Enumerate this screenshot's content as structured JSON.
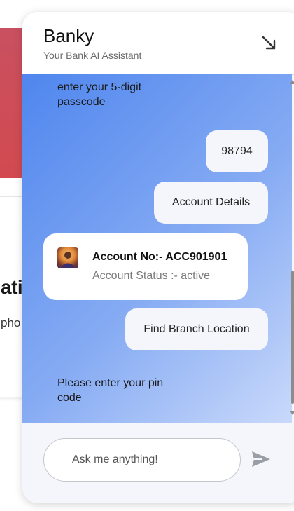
{
  "background": {
    "heading_fragment": "atio",
    "subtext_fragment": "pho"
  },
  "chat": {
    "title": "Banky",
    "subtitle": "Your Bank AI Assistant",
    "minimize_icon": "arrow-down-right-icon",
    "messages": {
      "bot_prompt_partial_line1": "enter your 5-digit",
      "bot_prompt_partial_line2": "passcode",
      "user_passcode": "98794",
      "user_account_details": "Account Details",
      "account_card": {
        "account_no": "Account No:- ACC901901",
        "account_status": "Account Status :- active"
      },
      "user_find_branch": "Find Branch Location",
      "bot_pin_prompt_line1": "Please enter your pin",
      "bot_pin_prompt_line2": "code"
    },
    "input": {
      "placeholder": "Ask me anything!",
      "value": ""
    },
    "send_icon": "send-icon"
  },
  "colors": {
    "accent_gradient_start": "#4f86ee",
    "accent_gradient_end": "#c9d9fb",
    "bubble_bg": "#f4f6fb",
    "brand_red": "#d24a50"
  }
}
